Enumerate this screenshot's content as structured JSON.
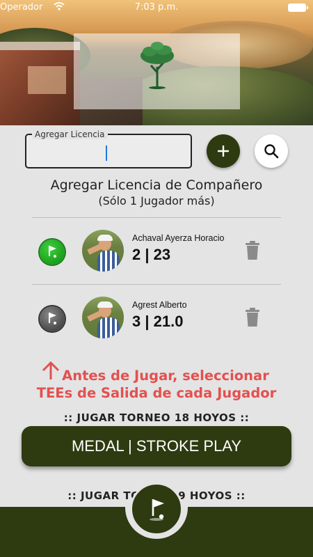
{
  "status_bar": {
    "carrier": "Operador",
    "time": "7:03 p.m."
  },
  "license": {
    "label": "Agregar Licencia",
    "value": "",
    "placeholder": ""
  },
  "add_companion": {
    "title": "Agregar Licencia de Compañero",
    "subtitle": "(Sólo 1 Jugador más)"
  },
  "players": [
    {
      "name": "Achaval Ayerza Horacio",
      "stats": "2 | 23",
      "tee_color": "#1fa51f"
    },
    {
      "name": "Agrest Alberto",
      "stats": "3 | 21.0",
      "tee_color": "#5a5a5a"
    }
  ],
  "warning": {
    "line1": "Antes de Jugar, seleccionar",
    "line2": "TEEs de Salida de cada Jugador",
    "color": "#e35050"
  },
  "tournament18": {
    "heading": ":: JUGAR TORNEO 18 HOYOS ::",
    "button": "MEDAL | STROKE PLAY"
  },
  "tournament9": {
    "heading": ":: JUGAR TORNEO 9 HOYOS ::"
  },
  "icons": {
    "add": "plus-icon",
    "search": "search-icon",
    "tee": "golf-flag-icon",
    "trash": "trash-icon",
    "warning": "arrow-up-icon",
    "fab": "golf-flag-icon"
  },
  "colors": {
    "primary": "#2e3a10",
    "background": "#e4e4e4"
  }
}
